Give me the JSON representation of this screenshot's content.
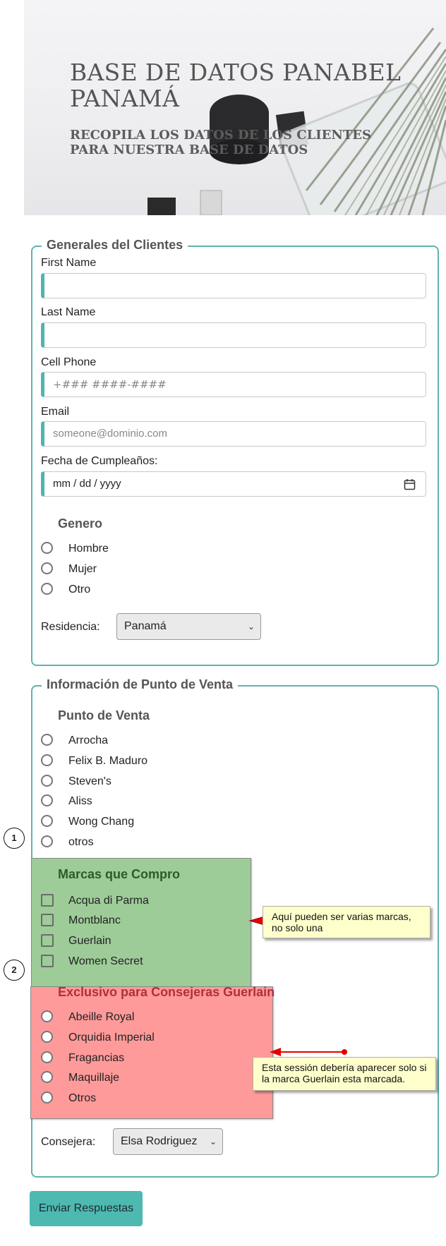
{
  "hero": {
    "title": "BASE DE DATOS PANABEL PANAMÁ",
    "subtitle": "RECOPILA LOS DATOS DE LOS CLIENTES PARA NUESTRA BASE DE DATOS"
  },
  "generales": {
    "legend": "Generales del Clientes",
    "first_name_label": "First Name",
    "first_name_value": "",
    "last_name_label": "Last Name",
    "last_name_value": "",
    "phone_label": "Cell Phone",
    "phone_placeholder": "+### ####-####",
    "email_label": "Email",
    "email_placeholder": "someone@dominio.com",
    "birthday_label": "Fecha de Cumpleaños:",
    "birthday_placeholder": "mm / dd / yyyy",
    "genero_title": "Genero",
    "genero_options": [
      "Hombre",
      "Mujer",
      "Otro"
    ],
    "residencia_label": "Residencia:",
    "residencia_value": "Panamá"
  },
  "venta": {
    "legend": "Información de Punto de Venta",
    "punto_title": "Punto de Venta",
    "punto_options": [
      "Arrocha",
      "Felix B. Maduro",
      "Steven's",
      "Aliss",
      "Wong Chang",
      "otros"
    ],
    "marcas_title": "Marcas que Compro",
    "marcas_options": [
      "Acqua di Parma",
      "Montblanc",
      "Guerlain",
      "Women Secret"
    ],
    "guerlain_title": "Exclusivo para Consejeras Guerlain",
    "guerlain_options": [
      "Abeille Royal",
      "Orquidia Imperial",
      "Fragancias",
      "Maquillaje",
      "Otros"
    ],
    "consejera_label": "Consejera:",
    "consejera_value": "Elsa Rodriguez"
  },
  "notes": {
    "note1": "Aquí pueden ser varias marcas, no solo una",
    "note2": "Esta sessión debería aparecer solo si la marca Guerlain esta marcada.",
    "marker1": "1",
    "marker2": "2"
  },
  "submit_label": "Enviar Respuestas",
  "colors": {
    "accent": "#4db9b1",
    "green_panel": "#9dcc98",
    "red_panel": "#ff9a9a"
  }
}
